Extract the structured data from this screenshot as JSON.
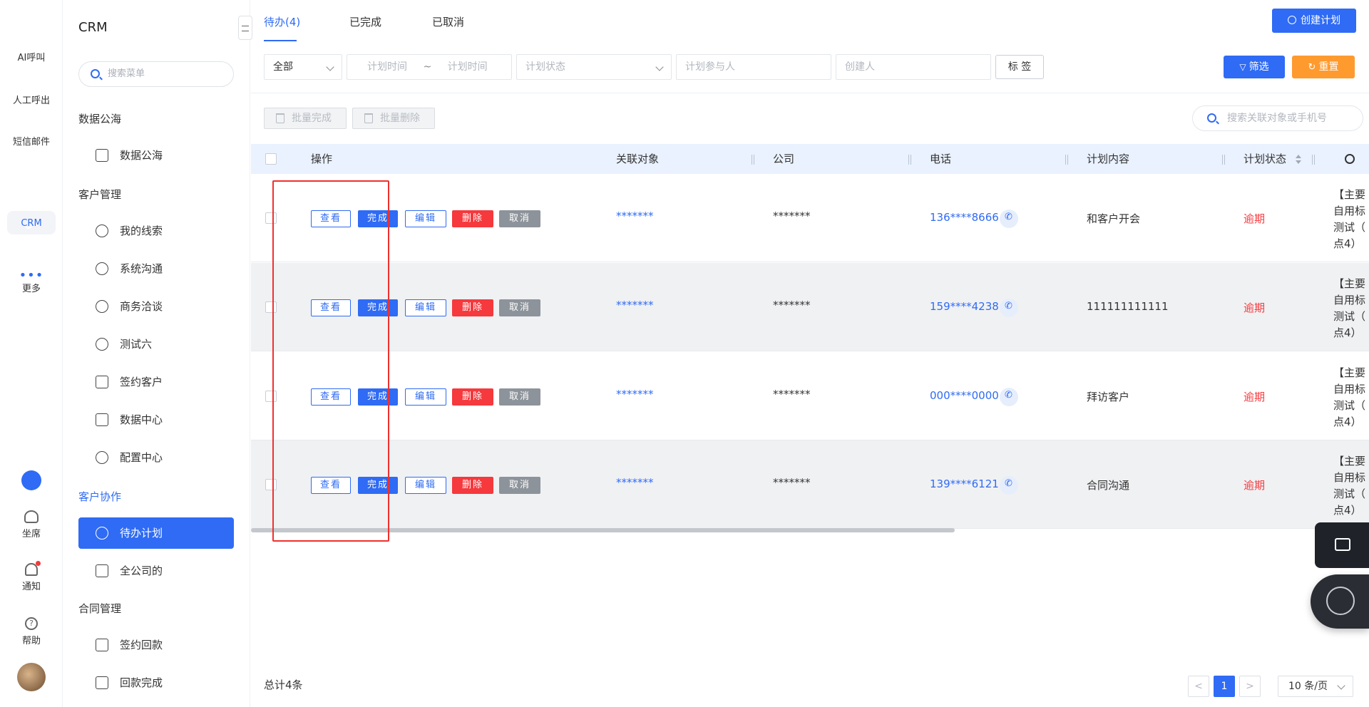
{
  "rail": {
    "items": [
      {
        "label": "AI呼叫"
      },
      {
        "label": "人工呼出"
      },
      {
        "label": "短信邮件"
      },
      {
        "label": "CRM"
      },
      {
        "label": "更多"
      },
      {
        "label": "坐席"
      },
      {
        "label": "通知"
      },
      {
        "label": "帮助"
      }
    ]
  },
  "sidebar": {
    "title": "CRM",
    "search_placeholder": "搜索菜单",
    "groups": [
      "数据公海",
      "客户管理",
      "客户协作",
      "合同管理"
    ],
    "items": [
      "数据公海",
      "我的线索",
      "系统沟通",
      "商务洽谈",
      "测试六",
      "签约客户",
      "数据中心",
      "配置中心",
      "待办计划",
      "全公司的",
      "签约回款",
      "回款完成"
    ]
  },
  "tabs": [
    "待办(4)",
    "已完成",
    "已取消"
  ],
  "create_button": "创建计划",
  "filters": {
    "scope": "全部",
    "time_start": "计划时间",
    "time_tilde": "~",
    "time_end": "计划时间",
    "status": "计划状态",
    "participant": "计划参与人",
    "creator": "创建人",
    "tag_button": "标 签",
    "filter_button": "筛选",
    "reset_button": "重置"
  },
  "batch": {
    "complete": "批量完成",
    "delete": "批量删除",
    "search_placeholder": "搜索关联对象或手机号"
  },
  "table": {
    "headers": [
      "操作",
      "关联对象",
      "公司",
      "电话",
      "计划内容",
      "计划状态"
    ],
    "actions": [
      "查看",
      "完成",
      "编辑",
      "删除",
      "取消"
    ],
    "rows": [
      {
        "object": "*******",
        "company": "*******",
        "phone": "136****8666",
        "content": "和客户开会",
        "status": "逾期",
        "extra": [
          "【主要",
          "自用标",
          "测试（",
          "点4）"
        ]
      },
      {
        "object": "*******",
        "company": "*******",
        "phone": "159****4238",
        "content": "111111111111",
        "status": "逾期",
        "extra": [
          "【主要",
          "自用标",
          "测试（",
          "点4）"
        ]
      },
      {
        "object": "*******",
        "company": "*******",
        "phone": "000****0000",
        "content": "拜访客户",
        "status": "逾期",
        "extra": [
          "【主要",
          "自用标",
          "测试（",
          "点4）"
        ]
      },
      {
        "object": "*******",
        "company": "*******",
        "phone": "139****6121",
        "content": "合同沟通",
        "status": "逾期",
        "extra": [
          "【主要",
          "自用标",
          "测试（",
          "点4）"
        ]
      }
    ]
  },
  "footer": {
    "total": "总计4条",
    "prev": "<",
    "page": "1",
    "next": ">",
    "page_size": "10 条/页"
  },
  "colors": {
    "primary": "#2f6bf4",
    "danger": "#f5393d",
    "warning": "#ff9a2e",
    "muted": "#8d939a"
  }
}
